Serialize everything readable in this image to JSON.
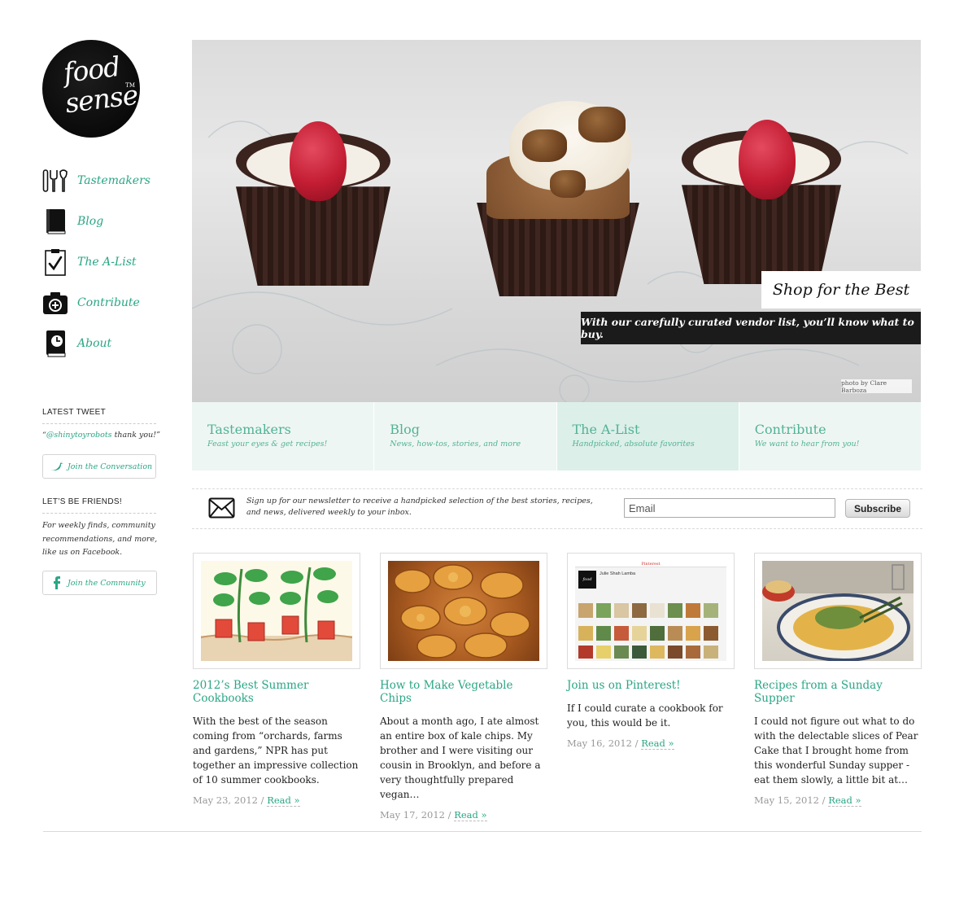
{
  "brand": {
    "logo_line1": "food",
    "logo_line2": "sense",
    "logo_tm": "TM"
  },
  "nav": [
    {
      "label": "Tastemakers",
      "icon": "utensils-icon"
    },
    {
      "label": "Blog",
      "icon": "book-icon"
    },
    {
      "label": "The A-List",
      "icon": "clipboard-check-icon"
    },
    {
      "label": "Contribute",
      "icon": "camera-plus-icon"
    },
    {
      "label": "About",
      "icon": "book-clock-icon"
    }
  ],
  "sidebar": {
    "tweet_heading": "LATEST TWEET",
    "tweet_quote_open": "“",
    "tweet_handle": "@shinytoyrobots",
    "tweet_text": " thank you!”",
    "tweet_button": "Join the Conversation",
    "friends_heading": "LET’S BE FRIENDS!",
    "friends_text": "For weekly finds, community recommendations, and more, like us on Facebook.",
    "friends_button": "Join the Community"
  },
  "hero": {
    "title": "Shop for the Best",
    "subtitle": "With our carefully curated vendor list, you’ll know what to buy.",
    "credit": "photo by Clare Barboza"
  },
  "tabs": [
    {
      "title": "Tastemakers",
      "subtitle": "Feast your eyes & get recipes!"
    },
    {
      "title": "Blog",
      "subtitle": "News, how-tos, stories, and more"
    },
    {
      "title": "The A-List",
      "subtitle": "Handpicked, absolute favorites"
    },
    {
      "title": "Contribute",
      "subtitle": "We want to hear from you!"
    }
  ],
  "newsletter": {
    "text": "Sign up for our newsletter to receive a handpicked selection of the best stories, recipes, and news, delivered weekly to your inbox.",
    "email_placeholder": "Email",
    "button": "Subscribe"
  },
  "posts": [
    {
      "title": "2012’s Best Summer Cookbooks",
      "excerpt": "With the best of the season coming from “orchards, farms and gardens,” NPR has put together an impressive collection of 10 summer cookbooks.",
      "date": "May 23, 2012 / ",
      "read": "Read »"
    },
    {
      "title": "How to Make Vegetable Chips",
      "excerpt": "About a month ago, I ate almost an entire box of kale chips. My brother and I were visiting our cousin in Brooklyn, and before a very thoughtfully prepared vegan…",
      "date": "May 17, 2012 / ",
      "read": "Read »"
    },
    {
      "title": "Join us on Pinterest!",
      "excerpt": "If I could curate a cookbook for you, this would be it.",
      "date": "May 16, 2012 / ",
      "read": "Read »"
    },
    {
      "title": "Recipes from a Sunday Supper",
      "excerpt": "I could not figure out what to do with the delectable slices of Pear Cake that I brought home from this wonderful Sunday supper - eat them slowly, a little bit at…",
      "date": "May 15, 2012 / ",
      "read": "Read »"
    }
  ],
  "pinterest_thumb": {
    "brand": "Pinterest",
    "profile_name": "Julie Shah Lamba"
  },
  "colors": {
    "accent": "#2aa685",
    "tab_bg": "#eef6f3",
    "tab_active": "#dcefe9",
    "dark": "#1b1b1b"
  }
}
